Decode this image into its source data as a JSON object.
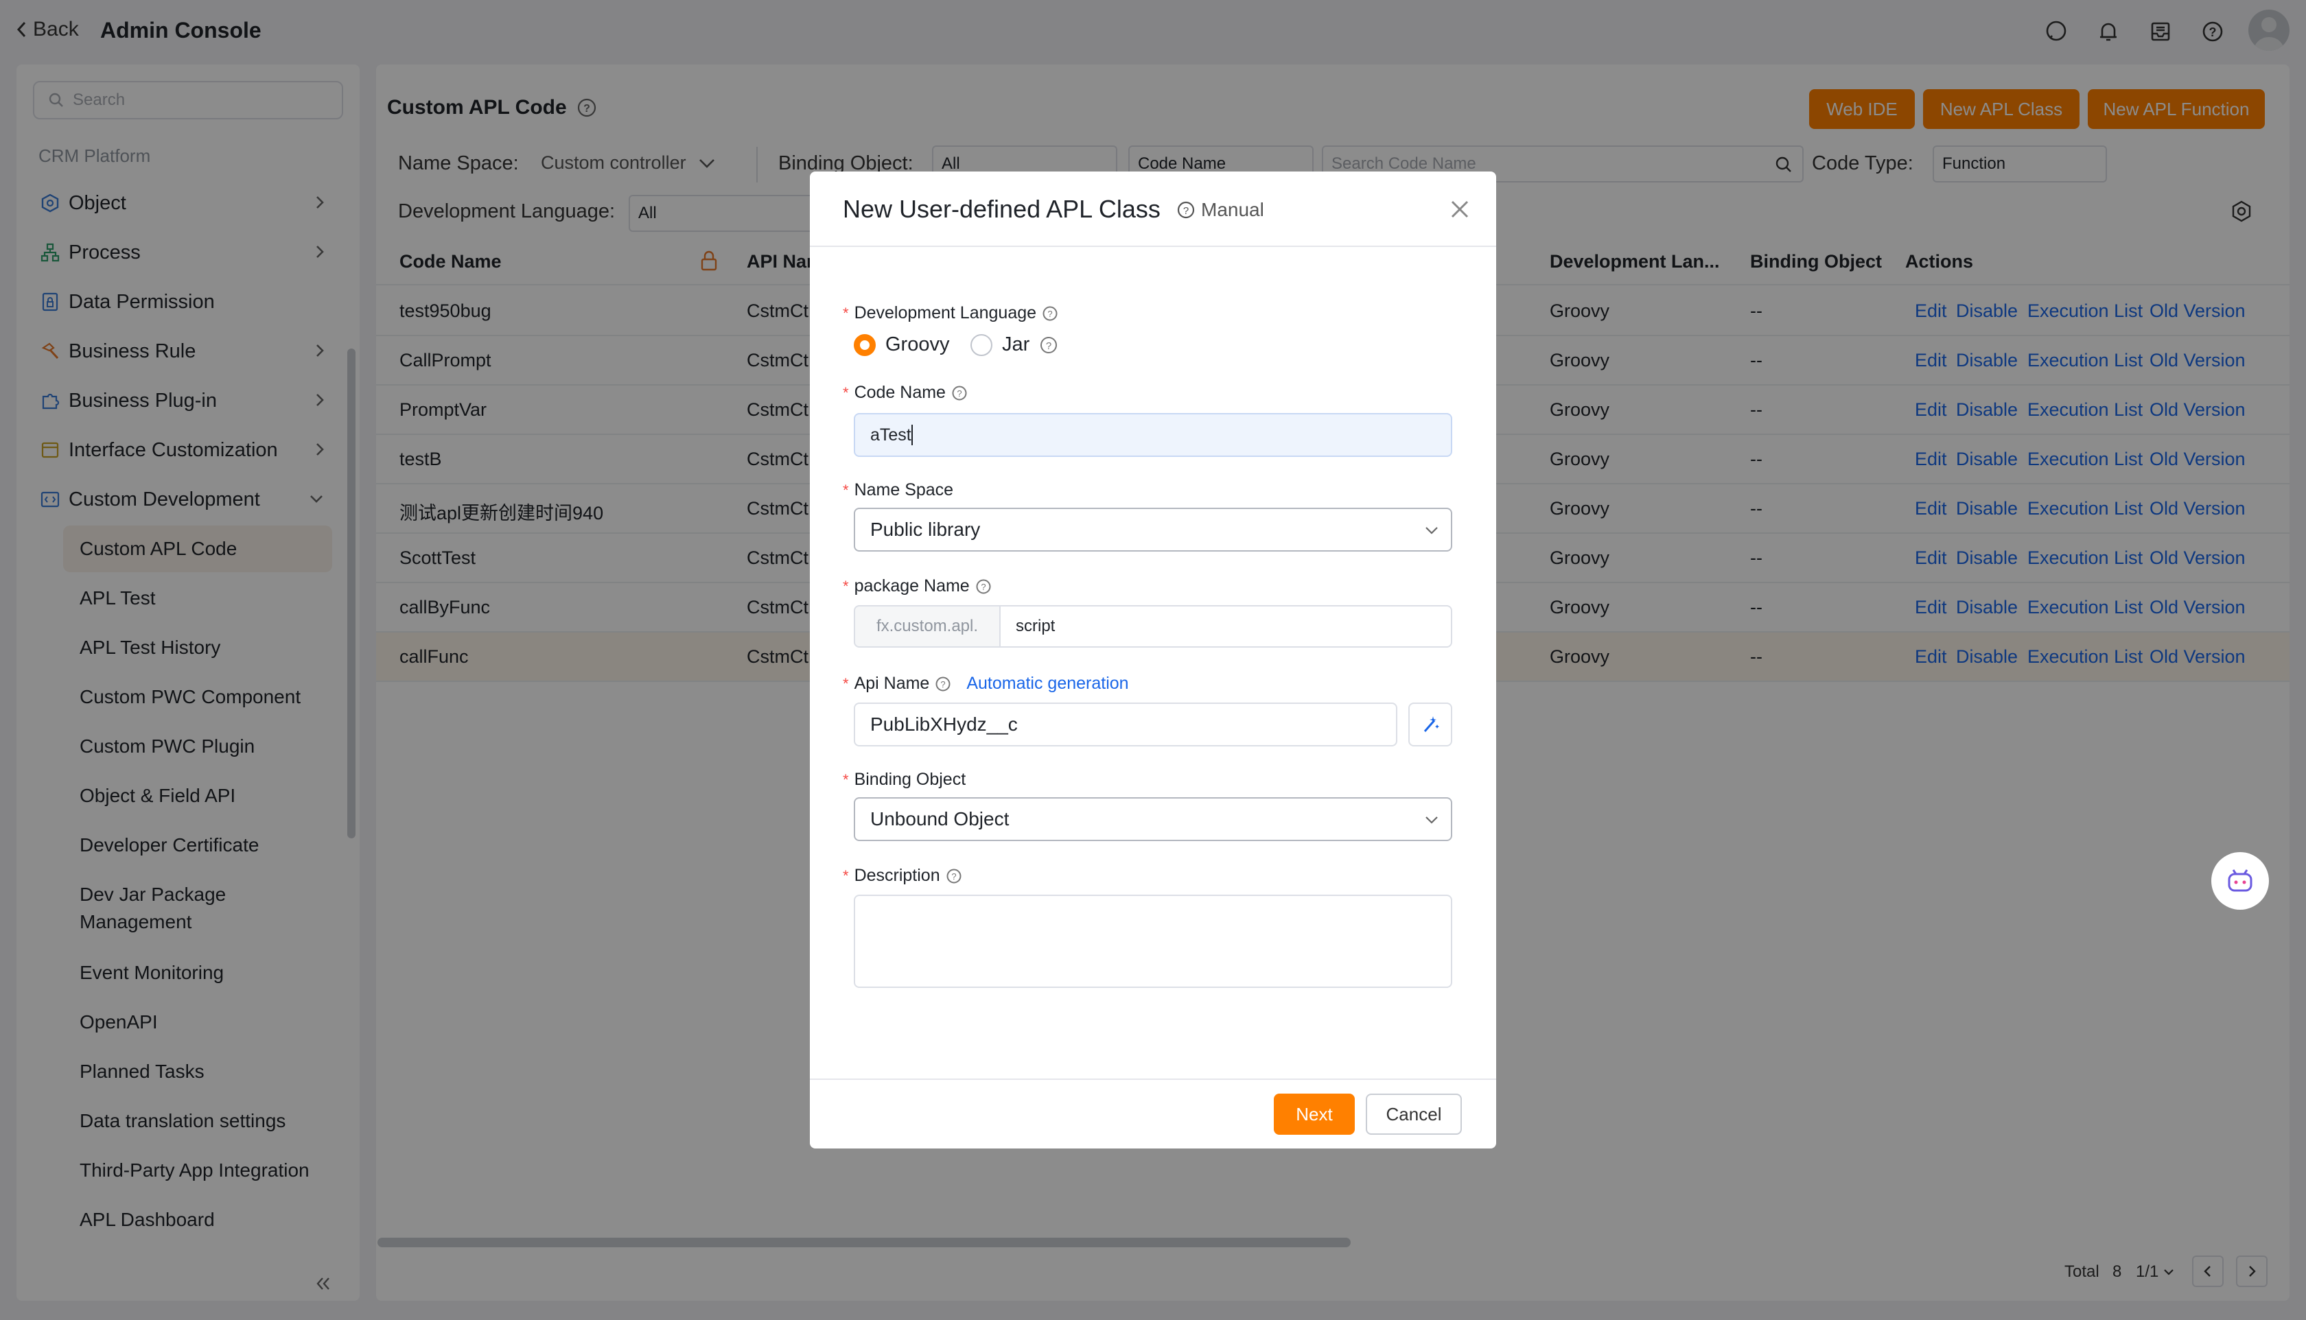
{
  "topbar": {
    "back_label": "Back",
    "title": "Admin Console"
  },
  "sidebar": {
    "search_placeholder": "Search",
    "section_label": "CRM Platform",
    "groups": [
      {
        "label": "Object"
      },
      {
        "label": "Process"
      },
      {
        "label": "Data Permission"
      },
      {
        "label": "Business Rule"
      },
      {
        "label": "Business Plug-in"
      },
      {
        "label": "Interface Customization"
      },
      {
        "label": "Custom Development"
      }
    ],
    "sub_items": [
      {
        "label": "Custom APL Code"
      },
      {
        "label": "APL Test"
      },
      {
        "label": "APL Test History"
      },
      {
        "label": "Custom PWC Component"
      },
      {
        "label": "Custom PWC Plugin"
      },
      {
        "label": "Object & Field API"
      },
      {
        "label": "Developer Certificate"
      },
      {
        "label": "Dev Jar Package Management"
      },
      {
        "label": "Event Monitoring"
      },
      {
        "label": "OpenAPI"
      },
      {
        "label": "Planned Tasks"
      },
      {
        "label": "Data translation settings"
      },
      {
        "label": "Third-Party App Integration"
      },
      {
        "label": "APL Dashboard"
      }
    ]
  },
  "main": {
    "title": "Custom APL Code",
    "buttons": {
      "web_ide": "Web IDE",
      "new_class": "New APL Class",
      "new_function": "New APL Function"
    },
    "filters": {
      "namespace_label": "Name Space:",
      "namespace_value": "Custom controller",
      "binding_label": "Binding Object:",
      "binding_value": "All",
      "code_name_select": "Code Name",
      "search_placeholder": "Search Code Name",
      "code_type_label": "Code Type:",
      "code_type_value": "Function",
      "dev_lang_label": "Development Language:",
      "dev_lang_value": "All"
    },
    "columns": {
      "code_name": "Code Name",
      "api_name": "API Nar",
      "dev_lang": "Development Lan...",
      "binding": "Binding Object",
      "actions": "Actions"
    },
    "rows": [
      {
        "code_name": "test950bug",
        "api": "CstmCt",
        "lang": "Groovy",
        "binding": "--"
      },
      {
        "code_name": "CallPrompt",
        "api": "CstmCt",
        "lang": "Groovy",
        "binding": "--"
      },
      {
        "code_name": "PromptVar",
        "api": "CstmCt",
        "lang": "Groovy",
        "binding": "--"
      },
      {
        "code_name": "testB",
        "api": "CstmCt",
        "lang": "Groovy",
        "binding": "--"
      },
      {
        "code_name": "测试apl更新创建时间940",
        "api": "CstmCt",
        "lang": "Groovy",
        "binding": "--"
      },
      {
        "code_name": "ScottTest",
        "api": "CstmCt",
        "lang": "Groovy",
        "binding": "--"
      },
      {
        "code_name": "callByFunc",
        "api": "CstmCt",
        "lang": "Groovy",
        "binding": "--"
      },
      {
        "code_name": "callFunc",
        "api": "CstmCt",
        "lang": "Groovy",
        "binding": "--"
      }
    ],
    "actions": {
      "edit": "Edit",
      "disable": "Disable",
      "exec": "Execution List",
      "old": "Old Version"
    },
    "pager": {
      "total_label": "Total",
      "total": "8",
      "page": "1/1"
    }
  },
  "modal": {
    "title": "New User-defined APL Class",
    "manual": "Manual",
    "dev_lang_label": "Development Language",
    "opt_groovy": "Groovy",
    "opt_jar": "Jar",
    "code_name_label": "Code Name",
    "code_name_value": "aTest",
    "namespace_label": "Name Space",
    "namespace_value": "Public library",
    "package_label": "package Name",
    "package_prefix": "fx.custom.apl.",
    "package_value": "script",
    "api_name_label": "Api Name",
    "auto_gen": "Automatic generation",
    "api_name_value": "PubLibXHydz__c",
    "binding_label": "Binding Object",
    "binding_value": "Unbound Object",
    "description_label": "Description",
    "next": "Next",
    "cancel": "Cancel"
  },
  "colors": {
    "accent": "#ff8000",
    "link": "#1a66e8"
  }
}
